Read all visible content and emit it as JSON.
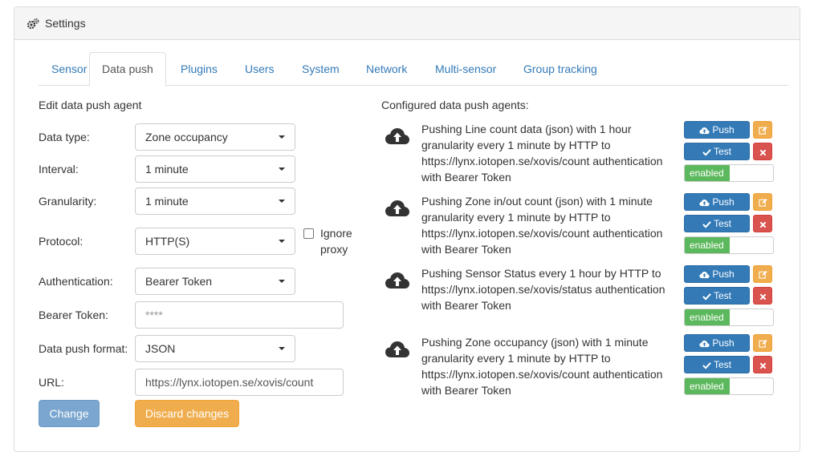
{
  "panel": {
    "title": "Settings"
  },
  "tabs": [
    {
      "label": "Sensor"
    },
    {
      "label": "Data push"
    },
    {
      "label": "Plugins"
    },
    {
      "label": "Users"
    },
    {
      "label": "System"
    },
    {
      "label": "Network"
    },
    {
      "label": "Multi-sensor"
    },
    {
      "label": "Group tracking"
    }
  ],
  "form": {
    "title": "Edit data push agent",
    "data_type": {
      "label": "Data type:",
      "value": "Zone occupancy"
    },
    "interval": {
      "label": "Interval:",
      "value": "1 minute"
    },
    "granularity": {
      "label": "Granularity:",
      "value": "1 minute"
    },
    "protocol": {
      "label": "Protocol:",
      "value": "HTTP(S)"
    },
    "ignore_proxy": {
      "label_line1": "Ignore",
      "label_line2": "proxy",
      "checked": false
    },
    "authentication": {
      "label": "Authentication:",
      "value": "Bearer Token"
    },
    "bearer_token": {
      "label": "Bearer Token:",
      "placeholder": "****"
    },
    "format": {
      "label": "Data push format:",
      "value": "JSON"
    },
    "url": {
      "label": "URL:",
      "value": "https://lynx.iotopen.se/xovis/count"
    },
    "change_button": "Change",
    "discard_button": "Discard changes"
  },
  "agents": {
    "title": "Configured data push agents:",
    "push_label": "Push",
    "test_label": "Test",
    "enabled_label": "enabled",
    "items": [
      {
        "lines": [
          "Pushing Line count data (json) with 1 hour",
          "granularity every 1 minute by HTTP to",
          "https://lynx.iotopen.se/xovis/count authentication",
          "with Bearer Token"
        ]
      },
      {
        "lines": [
          "Pushing Zone in/out count (json) with 1 minute",
          "granularity every 1 minute by HTTP to",
          "https://lynx.iotopen.se/xovis/count authentication",
          "with Bearer Token"
        ]
      },
      {
        "lines": [
          "Pushing Sensor Status every 1 hour by HTTP to",
          "https://lynx.iotopen.se/xovis/status authentication",
          "with Bearer Token"
        ]
      },
      {
        "lines": [
          "Pushing Zone occupancy (json) with 1 minute",
          "granularity every 1 minute by HTTP to",
          "https://lynx.iotopen.se/xovis/count authentication",
          "with Bearer Token"
        ]
      }
    ]
  },
  "colors": {
    "link": "#337ab7",
    "primary": "#337ab7",
    "warning": "#f0ad4e",
    "danger": "#d9534f",
    "success": "#5cb85c"
  }
}
